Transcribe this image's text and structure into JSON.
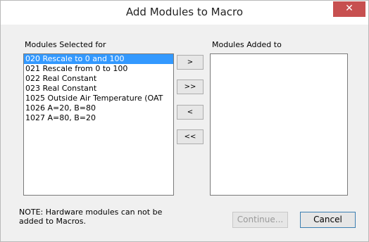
{
  "dialog": {
    "title": "Add Modules to Macro",
    "close_glyph": "✕"
  },
  "left_list": {
    "label": "Modules Selected for",
    "items": [
      "020 Rescale to 0 and 100",
      "021 Rescale from 0 to 100",
      "022 Real Constant",
      "023 Real Constant",
      "1025   Outside Air Temperature (OAT",
      "1026   A=20, B=80",
      "1027   A=80, B=20"
    ],
    "selected_index": 0
  },
  "right_list": {
    "label": "Modules Added to",
    "items": []
  },
  "move_buttons": {
    "add": ">",
    "add_all": ">>",
    "remove": "<",
    "remove_all": "<<"
  },
  "note": {
    "line1": "NOTE: Hardware modules can not be",
    "line2": "added to Macros."
  },
  "buttons": {
    "continue": "Continue...",
    "cancel": "Cancel"
  },
  "colors": {
    "selection": "#3399ff",
    "close": "#c75050",
    "dialog_bg": "#f0f0f0"
  }
}
